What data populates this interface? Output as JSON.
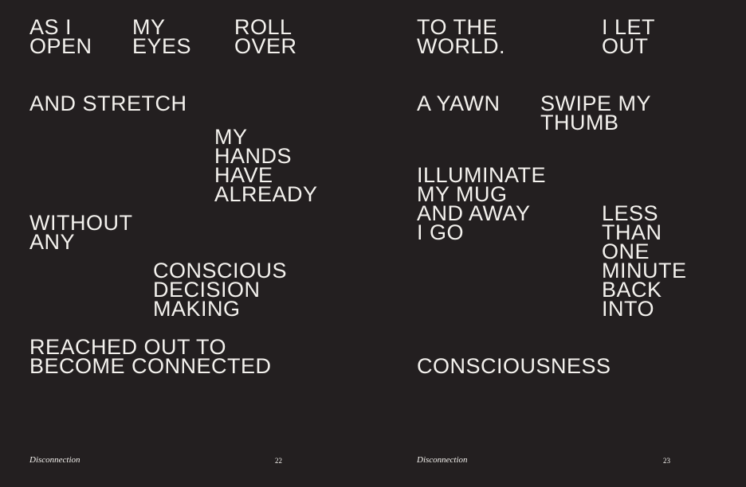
{
  "left_page": {
    "blocks": [
      "AS I\nOPEN",
      "MY\nEYES",
      "ROLL\nOVER",
      "AND STRETCH",
      "MY\nHANDS\nHAVE\nALREADY",
      "WITHOUT\nANY",
      "CONSCIOUS\nDECISION\nMAKING",
      "REACHED OUT TO\nBECOME CONNECTED"
    ],
    "running_title": "Disconnection",
    "page_number": "22"
  },
  "right_page": {
    "blocks": [
      "TO THE\nWORLD.",
      "I LET\nOUT",
      "A YAWN",
      "SWIPE MY\nTHUMB",
      "ILLUMINATE\nMY MUG\nAND AWAY\nI GO",
      "LESS\nTHAN\nONE\nMINUTE\nBACK\nINTO",
      "CONSCIOUSNESS"
    ],
    "running_title": "Disconnection",
    "page_number": "23"
  },
  "colors": {
    "background": "#231f20",
    "text": "#f4f2ee"
  }
}
